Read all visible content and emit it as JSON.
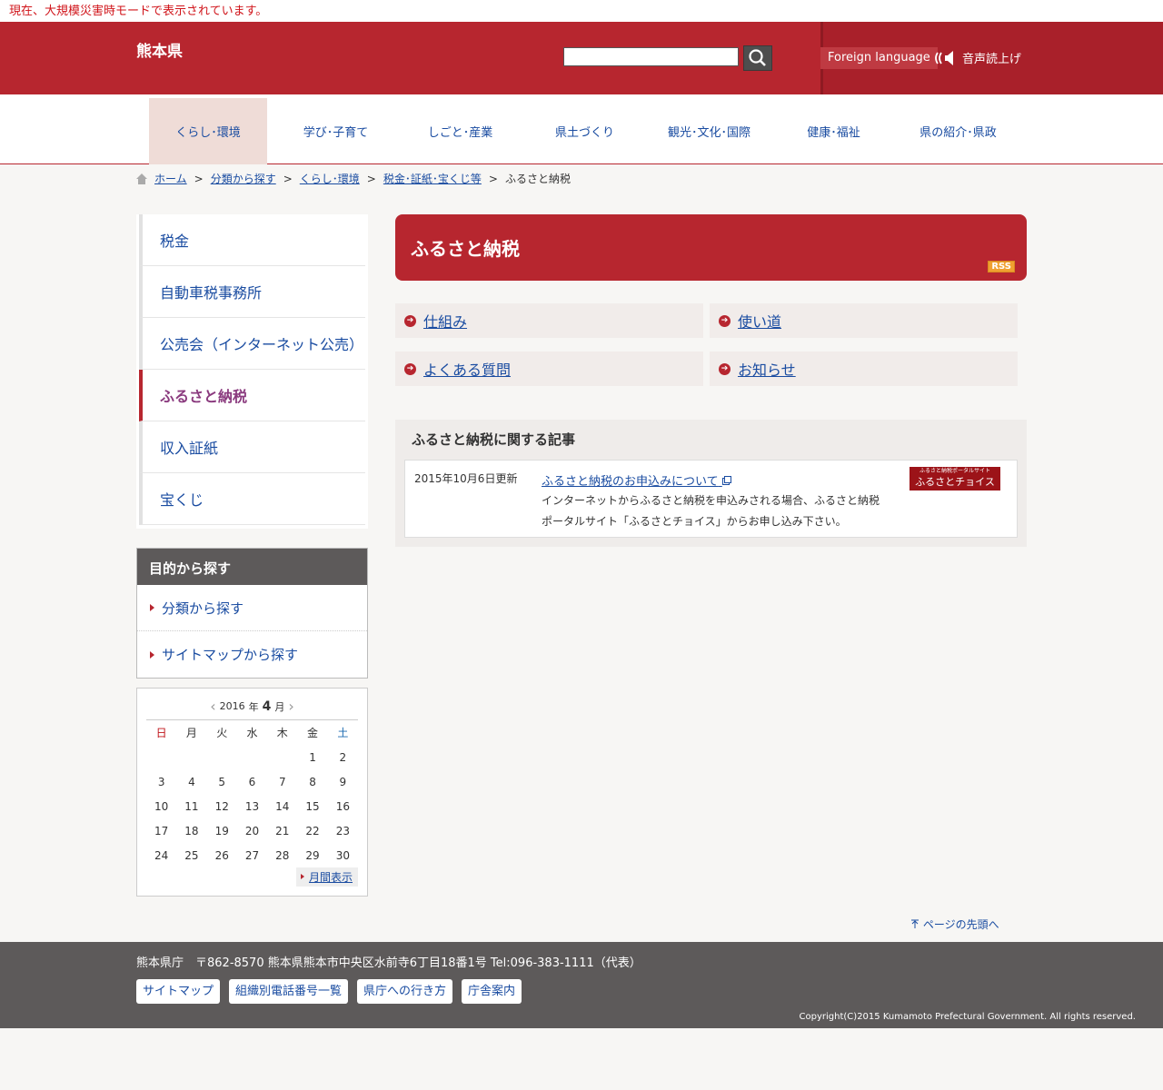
{
  "emergency_notice": "現在、大規模災害時モードで表示されています。",
  "header": {
    "site_title": "熊本県",
    "search_placeholder": "",
    "foreign_language": "Foreign language",
    "speech": "音声読上げ"
  },
  "gnav": [
    {
      "label": "くらし･環境",
      "active": true
    },
    {
      "label": "学び･子育て"
    },
    {
      "label": "しごと･産業"
    },
    {
      "label": "県土づくり"
    },
    {
      "label": "観光･文化･国際"
    },
    {
      "label": "健康･福祉"
    },
    {
      "label": "県の紹介･県政"
    }
  ],
  "breadcrumb": {
    "items": [
      "ホーム",
      "分類から探す",
      "くらし･環境",
      "税金･証紙･宝くじ等"
    ],
    "current": "ふるさと納税",
    "separator": ">"
  },
  "sidebar": {
    "items": [
      "税金",
      "自動車税事務所",
      "公売会（インターネット公売）",
      "ふるさと納税",
      "収入証紙",
      "宝くじ"
    ],
    "active_index": 3,
    "purpose_title": "目的から探す",
    "purpose_items": [
      "分類から探す",
      "サイトマップから探す"
    ]
  },
  "calendar": {
    "year": "2016",
    "year_unit": "年",
    "month": "4",
    "month_unit": "月",
    "dow": [
      "日",
      "月",
      "火",
      "水",
      "木",
      "金",
      "土"
    ],
    "weeks": [
      [
        "",
        "",
        "",
        "",
        "",
        "1",
        "2"
      ],
      [
        "3",
        "4",
        "5",
        "6",
        "7",
        "8",
        "9"
      ],
      [
        "10",
        "11",
        "12",
        "13",
        "14",
        "15",
        "16"
      ],
      [
        "17",
        "18",
        "19",
        "20",
        "21",
        "22",
        "23"
      ],
      [
        "24",
        "25",
        "26",
        "27",
        "28",
        "29",
        "30"
      ]
    ],
    "month_view": "月間表示"
  },
  "main": {
    "title": "ふるさと納税",
    "rss": "RSS",
    "categories": [
      "仕組み",
      "使い道",
      "よくある質問",
      "お知らせ"
    ],
    "articles_title": "ふるさと納税に関する記事",
    "article": {
      "date": "2015年10月6日更新",
      "title": "ふるさと納税のお申込みについて",
      "desc": "インターネットからふるさと納税を申込みされる場合、ふるさと納税ポータルサイト「ふるさとチョイス」からお申し込み下さい。",
      "banner_line1": "ふるさと納税ポータルサイト",
      "banner_line2": "ふるさとチョイス"
    }
  },
  "page_top": "ページの先頭へ",
  "footer": {
    "address": "熊本県庁　〒862-8570  熊本県熊本市中央区水前寺6丁目18番1号   Tel:096-383-1111（代表）",
    "links": [
      "サイトマップ",
      "組織別電話番号一覧",
      "県庁への行き方",
      "庁舎案内"
    ],
    "copyright": "Copyright(C)2015 Kumamoto Prefectural Government. All rights reserved."
  },
  "colors": {
    "brand_red": "#b7262f",
    "link_blue": "#1a4ca1",
    "footer_gray": "#5d5a5a"
  }
}
